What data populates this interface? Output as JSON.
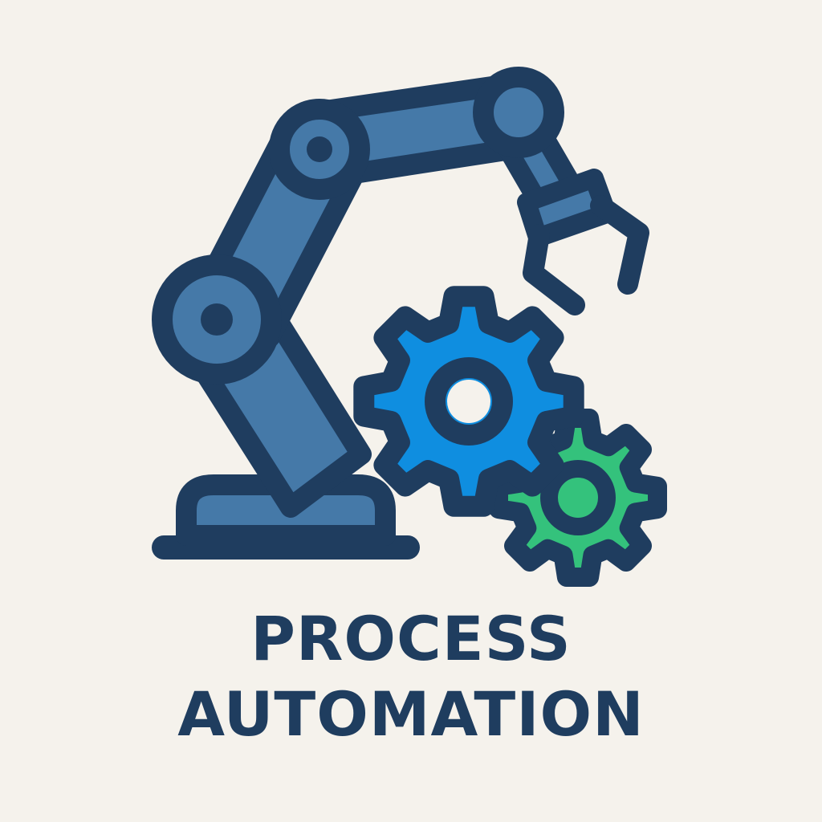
{
  "logo": {
    "caption_lines": [
      "PROCESS",
      "AUTOMATION"
    ],
    "icon_names": [
      "robotic-arm-icon",
      "gear-icon"
    ]
  },
  "colors": {
    "background": "#f5f2ec",
    "outline": "#1f3d5f",
    "arm_fill": "#4579a8",
    "large_gear": "#0f8ee0",
    "small_gear": "#34c27c",
    "text": "#1f3d5f"
  }
}
